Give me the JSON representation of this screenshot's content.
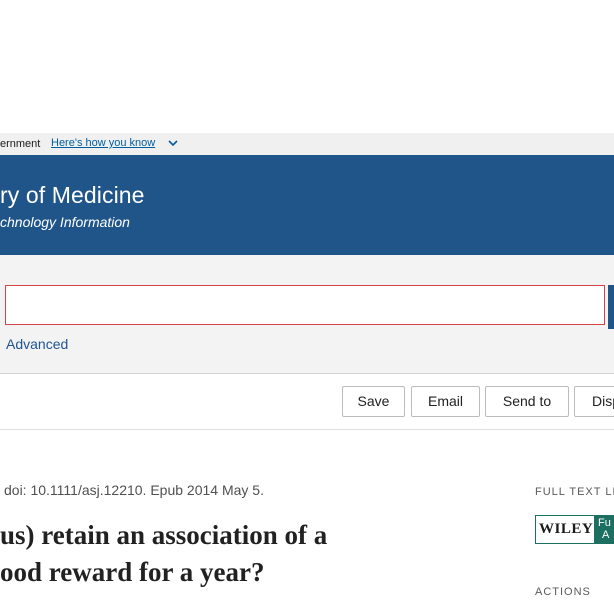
{
  "gov_banner": {
    "text": "ernment",
    "link": "Here's how you know"
  },
  "header": {
    "title": "ry of Medicine",
    "subtitle": "chnology Information"
  },
  "search": {
    "query": "",
    "advanced_label": "Advanced"
  },
  "toolbar": {
    "save": "Save",
    "email": "Email",
    "send_to": "Send to",
    "display": "Disp"
  },
  "article": {
    "meta": "doi: 10.1111/asj.12210. Epub 2014 May 5.",
    "title_line_1": "us) retain an association of a",
    "title_line_2": "ood reward for a year?"
  },
  "sidebar": {
    "full_text_heading": "FULL TEXT LIN",
    "wiley_word": "WILEY",
    "wiley_green_top": "Fu",
    "wiley_green_bottom": "A",
    "actions_heading": "ACTIONS"
  },
  "colors": {
    "header_bg": "#20558a",
    "search_border": "#d54349",
    "link": "#005ea2",
    "wiley_green": "#1d6f61"
  }
}
